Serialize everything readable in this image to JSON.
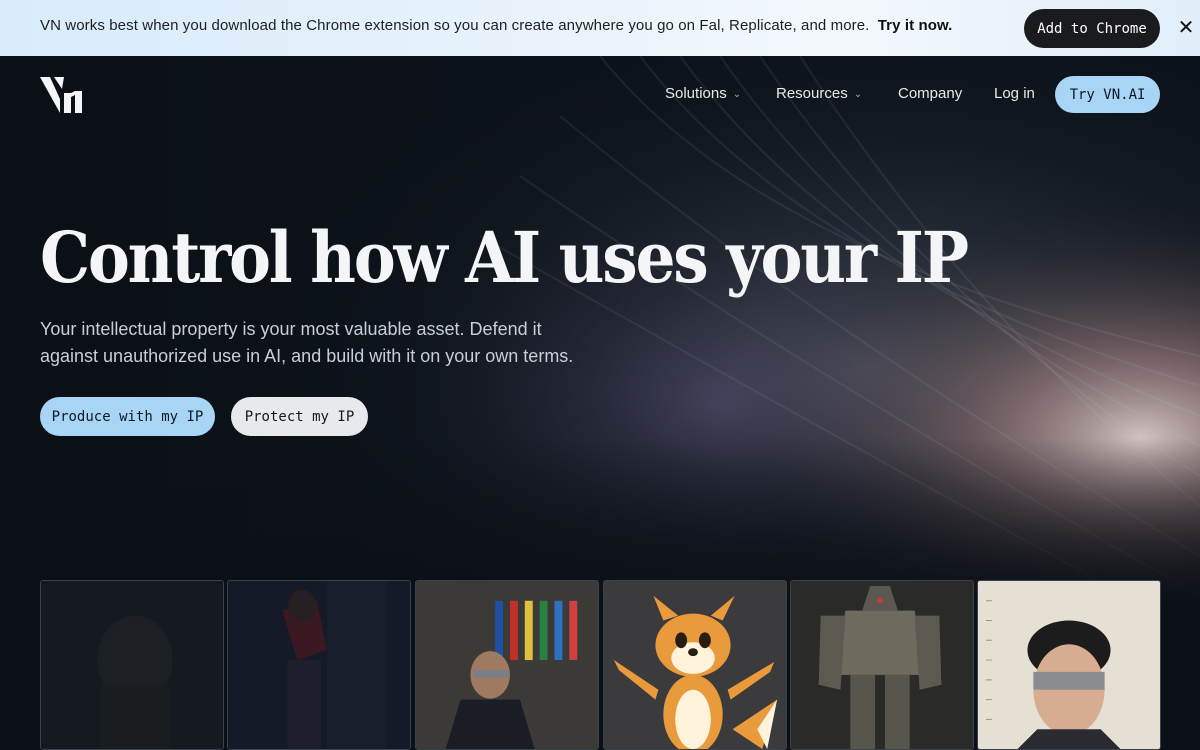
{
  "banner": {
    "message": "VN works best when you download the Chrome extension so you can create anywhere you go on Fal, Replicate, and more.",
    "cta": "Try it now.",
    "add_button": "Add to Chrome",
    "close_icon": "close-icon"
  },
  "nav": {
    "logo_icon": "vn-logo-icon",
    "items": [
      {
        "label": "Solutions",
        "has_dropdown": true
      },
      {
        "label": "Resources",
        "has_dropdown": true
      },
      {
        "label": "Company",
        "has_dropdown": false
      },
      {
        "label": "Log in",
        "has_dropdown": false
      }
    ],
    "try_button": "Try VN.AI"
  },
  "hero": {
    "headline": "Control how AI uses your IP",
    "subhead_line1": "Your intellectual property is your most valuable asset. Defend it",
    "subhead_line2": "against unauthorized use in AI, and build with it on your own terms.",
    "primary_button": "Produce with my IP",
    "secondary_button": "Protect my IP"
  },
  "thumbnails": [
    {
      "name": "armored-warrior-dark"
    },
    {
      "name": "woman-red-jacket-city"
    },
    {
      "name": "speaker-flags-conference"
    },
    {
      "name": "cartoon-fox-mascot"
    },
    {
      "name": "mech-armor-suit"
    },
    {
      "name": "person-mugshot"
    }
  ],
  "colors": {
    "accent_blue": "#a8d4f5",
    "banner_bg": "#e3f0fb",
    "page_bg": "#0b1016"
  }
}
